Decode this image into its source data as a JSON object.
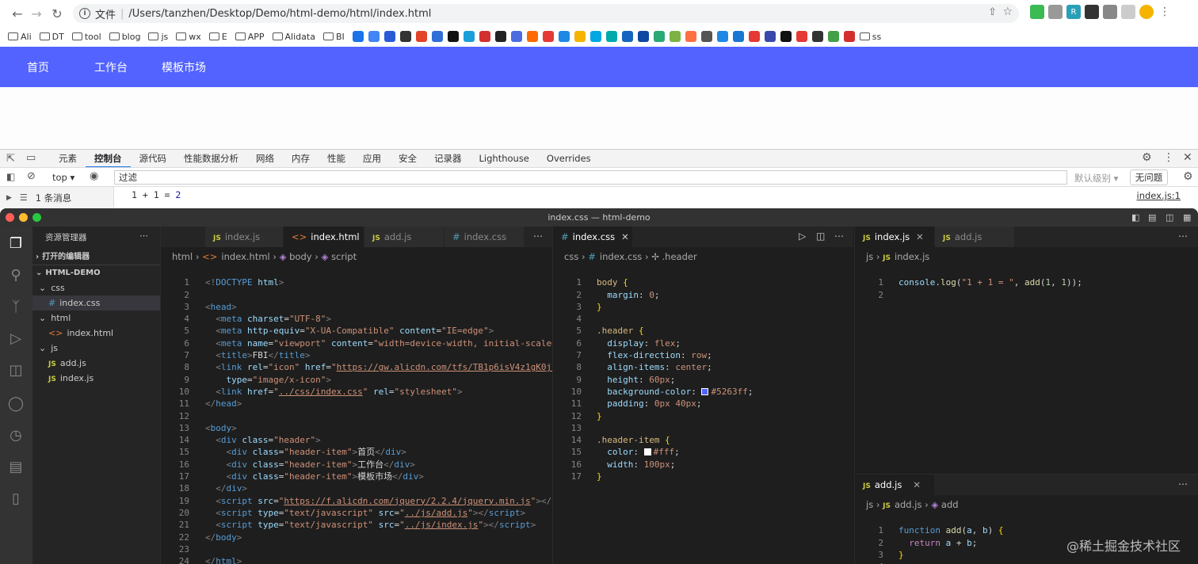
{
  "browser": {
    "url_scheme": "文件",
    "url_path": "/Users/tanzhen/Desktop/Demo/html-demo/html/index.html",
    "bookmarks": [
      "Ali",
      "DT",
      "tool",
      "blog",
      "js",
      "wx",
      "E",
      "APP",
      "Alidata",
      "BI"
    ],
    "bookmark_last": "ss"
  },
  "page": {
    "header_items": [
      "首页",
      "工作台",
      "模板市场"
    ],
    "header_color": "#5263ff"
  },
  "devtools": {
    "tabs": [
      "元素",
      "控制台",
      "源代码",
      "性能数据分析",
      "网络",
      "内存",
      "性能",
      "应用",
      "安全",
      "记录器",
      "Lighthouse",
      "Overrides"
    ],
    "active_tab": "控制台",
    "context": "top",
    "filter_placeholder": "过滤",
    "level": "默认级别",
    "issues": "无问题",
    "messages": "1 条消息",
    "log_text": "1 + 1 = ",
    "log_value": "2",
    "log_source": "index.js:1"
  },
  "vscode": {
    "title": "index.css — html-demo",
    "explorer_title": "资源管理器",
    "open_editors": "打开的编辑器",
    "project": "HTML-DEMO",
    "tree": [
      {
        "label": "css",
        "kind": "folder",
        "indent": 1
      },
      {
        "label": "index.css",
        "kind": "css",
        "indent": 2
      },
      {
        "label": "html",
        "kind": "folder",
        "indent": 1
      },
      {
        "label": "index.html",
        "kind": "html",
        "indent": 2
      },
      {
        "label": "js",
        "kind": "folder",
        "indent": 1
      },
      {
        "label": "add.js",
        "kind": "js",
        "indent": 2
      },
      {
        "label": "index.js",
        "kind": "js",
        "indent": 2
      }
    ],
    "pane1": {
      "tabs": [
        "index.js",
        "index.html",
        "add.js",
        "index.css"
      ],
      "crumb": [
        "html",
        "index.html",
        "body",
        "script"
      ]
    },
    "pane2": {
      "tab": "index.css",
      "crumb": [
        "css",
        "index.css",
        ".header"
      ]
    },
    "pane3": {
      "tabs": [
        "index.js",
        "add.js"
      ],
      "crumb": [
        "js",
        "index.js"
      ]
    },
    "pane4": {
      "tab": "add.js",
      "crumb": [
        "js",
        "add.js",
        "add"
      ]
    }
  },
  "watermark": "@稀土掘金技术社区"
}
